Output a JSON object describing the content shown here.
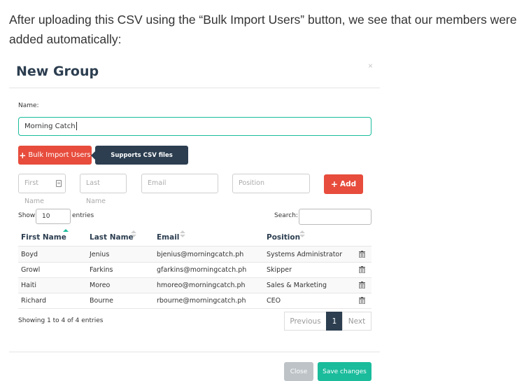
{
  "intro_text": "After uploading this CSV using the “Bulk Import Users” button, we see that our members were added automatically:",
  "modal": {
    "title": "New Group",
    "close_glyph": "×",
    "name_label": "Name:",
    "name_value": "Morning Catch",
    "bulk_import_label": "Bulk Import Users",
    "tooltip": "Supports CSV files",
    "fields": {
      "first_name": "First Name",
      "last_name": "Last Name",
      "email": "Email",
      "position": "Position"
    },
    "add_label": "Add",
    "show_label": "Show",
    "entries_value": "10",
    "entries_label": "entries",
    "search_label": "Search:",
    "columns": [
      "First Name",
      "Last Name",
      "Email",
      "Position"
    ],
    "sorted_column": "First Name",
    "rows": [
      {
        "first": "Boyd",
        "last": "Jenius",
        "email": "bjenius@morningcatch.ph",
        "position": "Systems Administrator"
      },
      {
        "first": "Growl",
        "last": "Farkins",
        "email": "gfarkins@morningcatch.ph",
        "position": "Skipper"
      },
      {
        "first": "Haiti",
        "last": "Moreo",
        "email": "hmoreo@morningcatch.ph",
        "position": "Sales & Marketing"
      },
      {
        "first": "Richard",
        "last": "Bourne",
        "email": "rbourne@morningcatch.ph",
        "position": "CEO"
      }
    ],
    "showing_text": "Showing 1 to 4 of 4 entries",
    "pagination": {
      "previous": "Previous",
      "current": "1",
      "next": "Next"
    },
    "close_label": "Close",
    "save_label": "Save changes"
  },
  "colors": {
    "accent": "#1abc9c",
    "danger": "#e74c3c",
    "dark": "#2c3e50",
    "muted": "#bdc3c7"
  },
  "icons": {
    "plus": "plus-icon",
    "trash": "trash-icon",
    "sort": "sort-icon",
    "contact_card": "contact-card-icon"
  }
}
